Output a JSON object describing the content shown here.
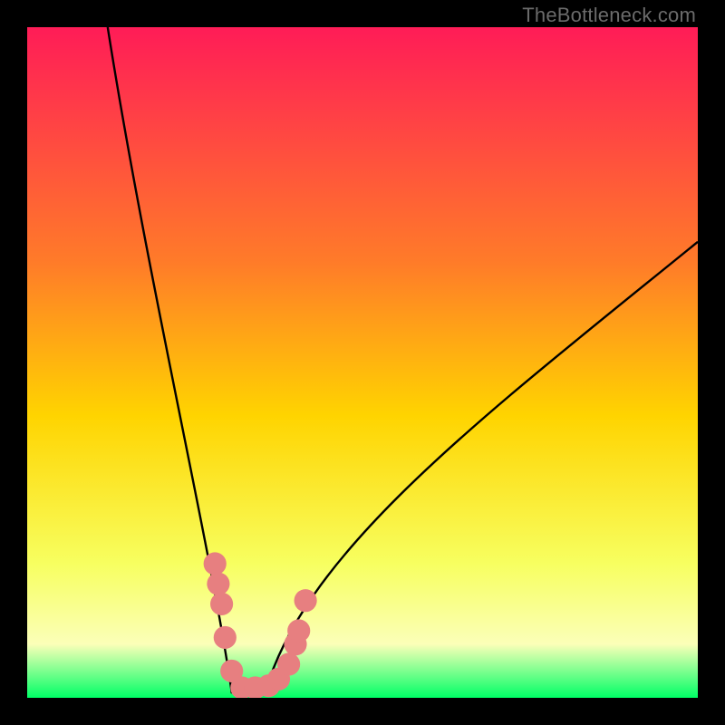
{
  "attribution": "TheBottleneck.com",
  "colors": {
    "frame": "#000000",
    "gradient_top": "#ff1c57",
    "gradient_mid_upper": "#ff7b29",
    "gradient_mid": "#ffd400",
    "gradient_lower": "#f7ff60",
    "gradient_pale": "#fbffb8",
    "gradient_bottom": "#00ff66",
    "curve": "#000000",
    "markers": "#e77f80"
  },
  "chart_data": {
    "type": "line",
    "title": "",
    "xlabel": "",
    "ylabel": "",
    "xlim": [
      0,
      100
    ],
    "ylim": [
      0,
      100
    ],
    "curve": {
      "min_x": 33,
      "left_start_x": 12,
      "left_start_y": 100,
      "right_end_x": 100,
      "right_end_y": 68,
      "flat_bottom_width": 5
    },
    "markers": [
      {
        "x": 28,
        "y": 20
      },
      {
        "x": 28.5,
        "y": 17
      },
      {
        "x": 29,
        "y": 14
      },
      {
        "x": 29.5,
        "y": 9
      },
      {
        "x": 30.5,
        "y": 4
      },
      {
        "x": 32,
        "y": 1.5
      },
      {
        "x": 34,
        "y": 1.5
      },
      {
        "x": 36,
        "y": 1.8
      },
      {
        "x": 37.5,
        "y": 2.8
      },
      {
        "x": 39,
        "y": 5
      },
      {
        "x": 40,
        "y": 8
      },
      {
        "x": 40.5,
        "y": 10
      },
      {
        "x": 41.5,
        "y": 14.5
      }
    ],
    "marker_radius": 1.7
  }
}
